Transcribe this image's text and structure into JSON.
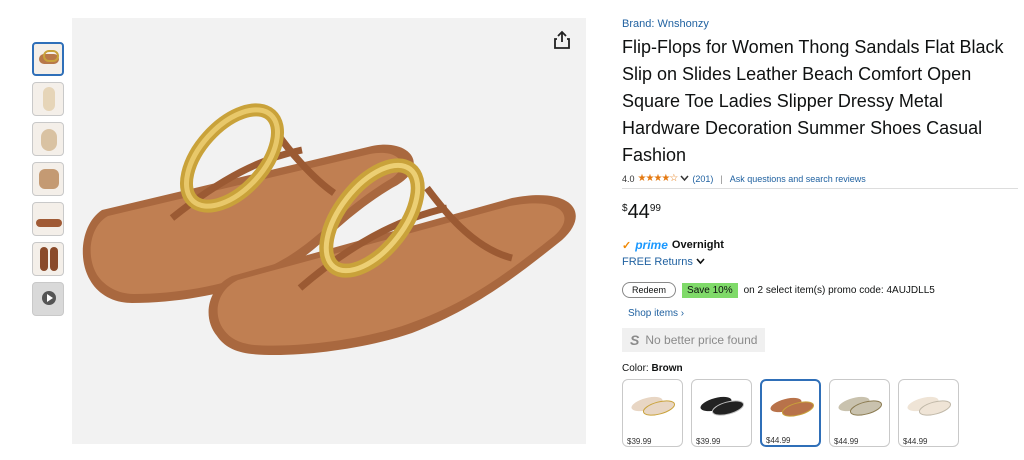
{
  "product": {
    "brand": "Brand: Wnshonzy",
    "title": "Flip-Flops for Women Thong Sandals Flat Black Slip on Slides Leather Beach Comfort Open Square Toe Ladies Slipper Dressy Metal Hardware Decoration Summer Shoes Casual Fashion",
    "rating_value": "4.0",
    "rating_stars": "★★★★☆",
    "review_count": "(201)",
    "ask_link": "Ask questions and search reviews",
    "price_currency": "$",
    "price_whole": "44",
    "price_fraction": "99"
  },
  "delivery": {
    "prime_label": "prime",
    "overnight": "Overnight",
    "free_returns": "FREE Returns"
  },
  "promo": {
    "redeem_label": "Redeem",
    "save_badge": "Save 10%",
    "promo_text": "on 2 select item(s) promo code: 4AUJDLL5",
    "shop_items": "Shop items ›"
  },
  "price_check": {
    "text": "No better price found",
    "icon": "S"
  },
  "color": {
    "label": "Color:",
    "selected": "Brown",
    "swatches": [
      {
        "price": "$39.99",
        "color": "#e8d6c4"
      },
      {
        "price": "$39.99",
        "color": "#222222"
      },
      {
        "price": "$44.99",
        "color": "#b8724a"
      },
      {
        "price": "$44.99",
        "color": "#c9c2ae"
      },
      {
        "price": "$44.99",
        "color": "#efe4d6"
      }
    ]
  },
  "thumbnails": [
    "thumb-1",
    "thumb-2",
    "thumb-3",
    "thumb-4",
    "thumb-5",
    "thumb-6",
    "video-thumb"
  ],
  "colors": {
    "link": "#2162a1",
    "star": "#e47911",
    "prime": "#1a98ff",
    "save_badge": "#7fda69",
    "sandal_leather": "#b8724a",
    "hardware_gold": "#c9a23a"
  }
}
